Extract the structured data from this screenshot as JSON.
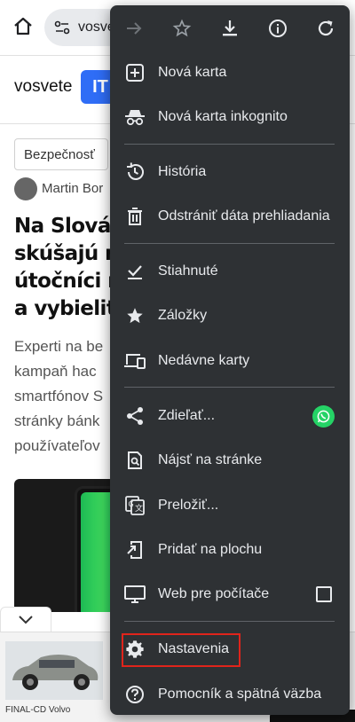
{
  "browser": {
    "url_text": "vosvete"
  },
  "page": {
    "logo_text": "vosvete",
    "logo_badge": "IT",
    "category": "Bezpečnosť",
    "author": "Martin Bor",
    "headline_lines": [
      "Na Slovák",
      "skúšajú no",
      "útočníci m",
      "a vybieliť t"
    ],
    "excerpt_lines": [
      "Experti na be",
      "kampaň hac",
      "smartfónov S",
      "stránky bánk",
      "používateľov"
    ]
  },
  "ad": {
    "caption": "FINAL-CD Volvo"
  },
  "menu": {
    "toolbar": [
      {
        "icon": "forward-arrow-icon"
      },
      {
        "icon": "star-outline-icon"
      },
      {
        "icon": "download-icon"
      },
      {
        "icon": "info-icon"
      },
      {
        "icon": "reload-icon"
      }
    ],
    "items": [
      {
        "id": "new-tab",
        "label": "Nová karta",
        "icon": "plus-box-icon"
      },
      {
        "id": "incognito",
        "label": "Nová karta inkognito",
        "icon": "incognito-icon"
      },
      {
        "id": "history",
        "label": "História",
        "icon": "history-icon"
      },
      {
        "id": "clear-data",
        "label": "Odstrániť dáta prehliadania",
        "icon": "trash-icon"
      },
      {
        "id": "downloads",
        "label": "Stiahnuté",
        "icon": "download-check-icon"
      },
      {
        "id": "bookmarks",
        "label": "Záložky",
        "icon": "star-filled-icon"
      },
      {
        "id": "recent-tabs",
        "label": "Nedávne karty",
        "icon": "devices-icon"
      },
      {
        "id": "share",
        "label": "Zdieľať...",
        "icon": "share-icon"
      },
      {
        "id": "find",
        "label": "Nájsť na stránke",
        "icon": "find-in-page-icon"
      },
      {
        "id": "translate",
        "label": "Preložiť...",
        "icon": "translate-icon"
      },
      {
        "id": "add-home",
        "label": "Pridať na plochu",
        "icon": "add-to-home-icon"
      },
      {
        "id": "desktop-site",
        "label": "Web pre počítače",
        "icon": "desktop-icon",
        "checked": false
      },
      {
        "id": "settings",
        "label": "Nastavenia",
        "icon": "gear-icon",
        "highlighted": true
      },
      {
        "id": "help",
        "label": "Pomocník a spätná väzba",
        "icon": "help-icon"
      }
    ],
    "highlight_color": "#e0241b",
    "background": "#2e3134"
  }
}
